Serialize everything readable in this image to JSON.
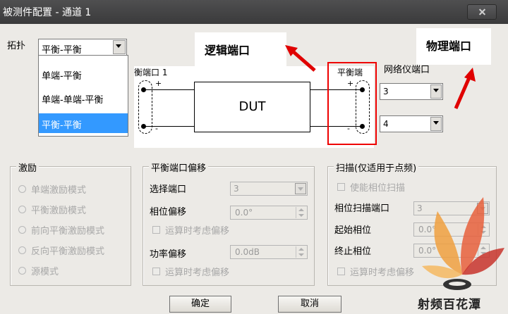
{
  "window": {
    "title": "被测件配置 - 通道 1"
  },
  "topology": {
    "label": "拓扑",
    "selected": "平衡-平衡",
    "options": [
      "单端-平衡",
      "单端-单端-平衡",
      "平衡-平衡"
    ]
  },
  "callouts": {
    "logical_port": "逻辑端口",
    "physical_port": "物理端口"
  },
  "diagram": {
    "dut_label": "DUT",
    "balanced_port_1": "衡端口 1",
    "balanced_port_right": "平衡端",
    "analyzer_ports": "网络仪端口",
    "plus": "+",
    "minus": "-",
    "port_a": "3",
    "port_b": "4"
  },
  "excitation": {
    "title": "激励",
    "options": [
      "单端激励模式",
      "平衡激励模式",
      "前向平衡激励模式",
      "反向平衡激励模式",
      "源模式"
    ]
  },
  "offset": {
    "title": "平衡端口偏移",
    "select_port_label": "选择端口",
    "select_port_value": "3",
    "phase_label": "相位偏移",
    "phase_value": "0.0°",
    "phase_check": "运算时考虑偏移",
    "power_label": "功率偏移",
    "power_value": "0.0dB",
    "power_check": "运算时考虑偏移"
  },
  "sweep": {
    "title": "扫描(仅适用于点频)",
    "enable_phase_sweep": "使能相位扫描",
    "phase_sweep_port_label": "相位扫描端口",
    "phase_sweep_port_value": "3",
    "start_phase_label": "起始相位",
    "start_phase_value": "0.0°",
    "stop_phase_label": "终止相位",
    "stop_phase_value": "0.0°",
    "check_label": "运算时考虑偏移"
  },
  "buttons": {
    "ok": "确定",
    "cancel": "取消"
  },
  "watermark": {
    "text": "射频百花潭"
  },
  "colors": {
    "highlight": "#3399ff",
    "callout_red": "#e00000",
    "titlebar": "#444445"
  }
}
